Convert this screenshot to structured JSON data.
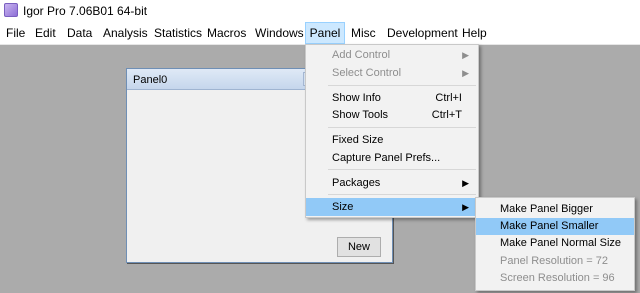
{
  "window": {
    "title": "Igor Pro 7.06B01 64-bit"
  },
  "menubar": {
    "items": [
      {
        "label": "File"
      },
      {
        "label": "Edit"
      },
      {
        "label": "Data"
      },
      {
        "label": "Analysis"
      },
      {
        "label": "Statistics"
      },
      {
        "label": "Macros"
      },
      {
        "label": "Windows"
      },
      {
        "label": "Panel"
      },
      {
        "label": "Misc"
      },
      {
        "label": "Development"
      },
      {
        "label": "Help"
      }
    ]
  },
  "panel_window": {
    "title": "Panel0",
    "new_button": "New"
  },
  "panel_menu": {
    "items": [
      {
        "label": "Add Control",
        "state": "disabled",
        "submenu": true
      },
      {
        "label": "Select Control",
        "state": "disabled",
        "submenu": true
      },
      {
        "label": "Show Info",
        "shortcut": "Ctrl+I"
      },
      {
        "label": "Show Tools",
        "shortcut": "Ctrl+T"
      },
      {
        "label": "Fixed Size"
      },
      {
        "label": "Capture Panel Prefs..."
      },
      {
        "label": "Packages",
        "submenu": true
      },
      {
        "label": "Size",
        "state": "highlighted",
        "submenu": true
      }
    ]
  },
  "size_submenu": {
    "items": [
      {
        "label": "Make Panel Bigger"
      },
      {
        "label": "Make Panel Smaller",
        "state": "highlighted"
      },
      {
        "label": "Make Panel Normal Size"
      },
      {
        "label": "Panel Resolution = 72",
        "state": "disabled"
      },
      {
        "label": "Screen Resolution = 96",
        "state": "disabled"
      }
    ]
  }
}
